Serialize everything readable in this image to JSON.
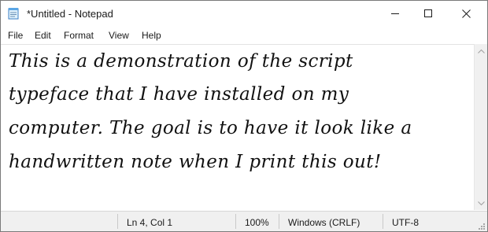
{
  "window": {
    "title": "*Untitled - Notepad",
    "app_icon": "notepad-icon",
    "controls": {
      "minimize_icon": "minimize-icon",
      "maximize_icon": "maximize-icon",
      "close_icon": "close-icon"
    }
  },
  "menu": {
    "file": "File",
    "edit": "Edit",
    "format": "Format",
    "view": "View",
    "help": "Help"
  },
  "editor": {
    "lines": [
      "This is a demonstration of the script",
      "typeface that I have installed on my",
      "computer. The goal is to have it look like a",
      "handwritten note when I print this out!"
    ]
  },
  "status": {
    "position": "Ln 4, Col 1",
    "zoom": "100%",
    "line_ending": "Windows (CRLF)",
    "encoding": "UTF-8"
  },
  "colors": {
    "text": "#111111",
    "chrome": "#ffffff",
    "statusbar": "#f0f0f0"
  }
}
